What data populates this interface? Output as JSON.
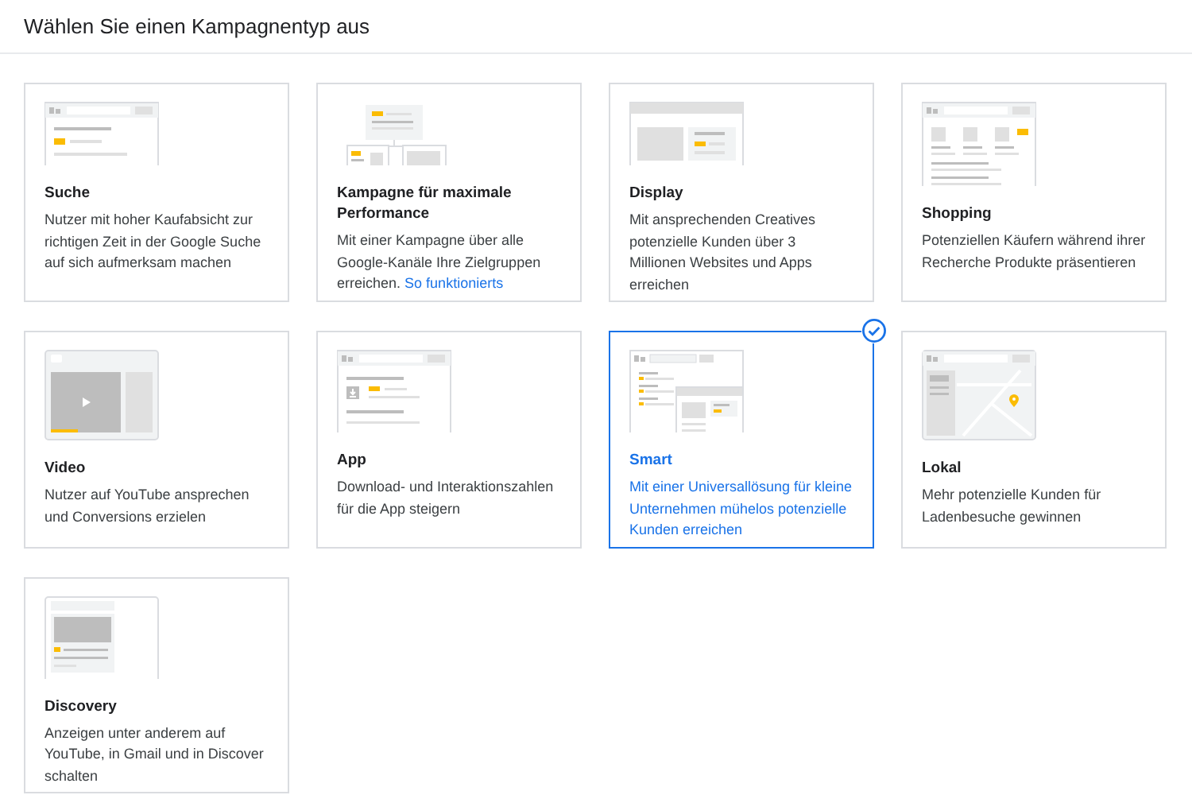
{
  "header": {
    "title": "Wählen Sie einen Kampagnentyp aus"
  },
  "cards": [
    {
      "kind": "search",
      "title": "Suche",
      "description": "Nutzer mit hoher Kaufabsicht zur richtigen Zeit in der Google Suche auf sich aufmerksam machen",
      "selected": false
    },
    {
      "kind": "pmax",
      "title": "Kampagne für maximale Performance",
      "description": "Mit einer Kampagne über alle Google-Kanäle Ihre Zielgruppen erreichen.",
      "link": "So funktionierts",
      "selected": false
    },
    {
      "kind": "display",
      "title": "Display",
      "description": "Mit ansprechenden Creatives potenzielle Kunden über 3 Millionen Websites und Apps erreichen",
      "selected": false
    },
    {
      "kind": "shopping",
      "title": "Shopping",
      "description": "Potenziellen Käufern während ihrer Recherche Produkte präsentieren",
      "selected": false
    },
    {
      "kind": "video",
      "title": "Video",
      "description": "Nutzer auf YouTube ansprechen und Conversions erzielen",
      "selected": false
    },
    {
      "kind": "app",
      "title": "App",
      "description": "Download- und Interaktionszahlen für die App steigern",
      "selected": false
    },
    {
      "kind": "smart",
      "title": "Smart",
      "description": "Mit einer Universallösung für kleine Unternehmen mühelos potenzielle Kunden erreichen",
      "selected": true
    },
    {
      "kind": "local",
      "title": "Lokal",
      "description": "Mehr potenzielle Kunden für Ladenbesuche gewinnen",
      "selected": false
    },
    {
      "kind": "discovery",
      "title": "Discovery",
      "description": "Anzeigen unter anderem auf YouTube, in Gmail und in Discover schalten",
      "selected": false
    }
  ]
}
